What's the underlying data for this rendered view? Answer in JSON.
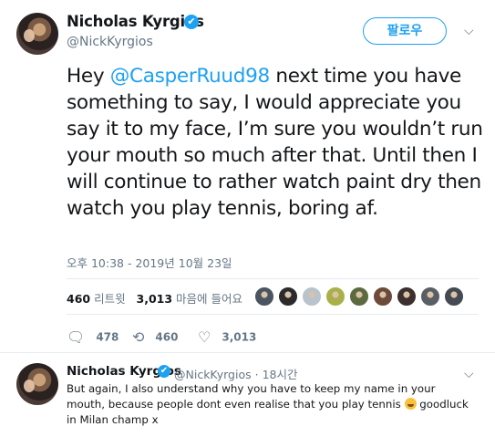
{
  "tweet": {
    "author_name": "Nicholas Kyrgios",
    "author_handle": "@NickKyrgios",
    "follow_label": "팔로우",
    "text_before_mention": "Hey ",
    "mention": "@CasperRuud98",
    "text_after_mention": " next time you have something to say, I would appreciate you say it to my face, I’m sure you wouldn’t run your mouth so much after that. Until then I will continue to rather watch paint dry then watch you play tennis, boring af.",
    "timestamp": "오후 10:38 - 2019년 10월 23일",
    "retweets_count": "460",
    "retweets_label": "리트윗",
    "likes_count": "3,013",
    "likes_label": "마음에 들어요",
    "actions": {
      "reply_count": "478",
      "retweet_count": "460",
      "like_count": "3,013"
    }
  },
  "reply": {
    "author_name": "Nicholas Kyrgios",
    "author_handle": "@NickKyrgios",
    "separator": "·",
    "time_ago": "18시간",
    "text": "But again, I also understand why you have to keep my name in your mouth, because people dont even realise that you play tennis",
    "text_after_emoji": " goodluck in Milan champ x"
  },
  "likers_avatars": [
    {
      "color": "#4a5560"
    },
    {
      "color": "#2b2b2b"
    },
    {
      "color": "#b9c3cc"
    },
    {
      "color": "#a9b04a"
    },
    {
      "color": "#5c6a3f"
    },
    {
      "color": "#6d4b3a"
    },
    {
      "color": "#3c2f2d"
    },
    {
      "color": "#5a5f63"
    },
    {
      "color": "#444a52"
    }
  ],
  "icons": {
    "verified": "✔",
    "chevron": "⌵",
    "reply": "🗨",
    "retweet": "⟲",
    "like": "♡"
  },
  "colors": {
    "accent": "#1da1f2",
    "muted": "#657786",
    "text": "#14171a"
  }
}
